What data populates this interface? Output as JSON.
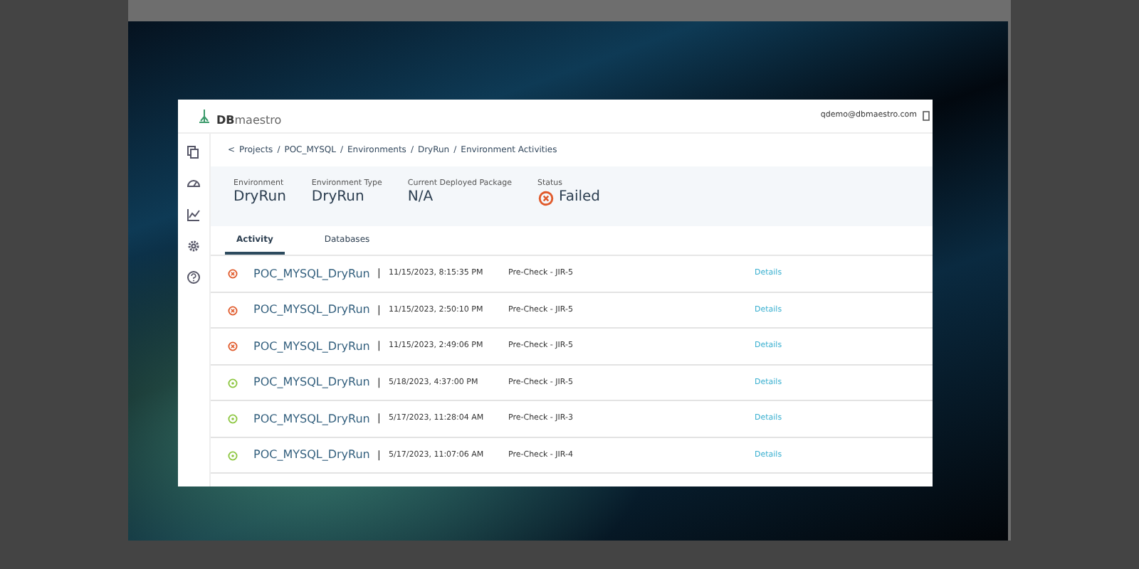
{
  "header": {
    "logo_bold": "DB",
    "logo_rest": "maestro",
    "user_email": "qdemo@dbmaestro.com"
  },
  "breadcrumb": {
    "back": "<",
    "items": [
      {
        "label": "Projects"
      },
      {
        "separator": "/",
        "label": "POC_MYSQL"
      },
      {
        "separator": "/",
        "label": "Environments"
      },
      {
        "separator": "/",
        "label": "DryRun"
      },
      {
        "separator": "/",
        "label": "Environment Activities"
      }
    ]
  },
  "summary": [
    {
      "label": "Environment",
      "value": "DryRun"
    },
    {
      "label": "Environment Type",
      "value": "DryRun"
    },
    {
      "label": "Current Deployed Package",
      "value": "N/A"
    },
    {
      "label": "Status",
      "value": "Failed",
      "kind": "failed"
    }
  ],
  "tabs": [
    {
      "label": "Activity",
      "selected": true
    },
    {
      "label": "Databases",
      "selected": false
    }
  ],
  "activities": [
    {
      "kind": "failed",
      "name": "POC_MYSQL_DryRun",
      "separator": "|",
      "time": "11/15/2023, 8:15:35 PM",
      "action": "Pre-Check - JIR-5",
      "link": "Details"
    },
    {
      "kind": "failed",
      "name": "POC_MYSQL_DryRun",
      "separator": "|",
      "time": "11/15/2023, 2:50:10 PM",
      "action": "Pre-Check - JIR-5",
      "link": "Details"
    },
    {
      "kind": "failed",
      "name": "POC_MYSQL_DryRun",
      "separator": "|",
      "time": "11/15/2023, 2:49:06 PM",
      "action": "Pre-Check - JIR-5",
      "link": "Details"
    },
    {
      "kind": "success",
      "name": "POC_MYSQL_DryRun",
      "separator": "|",
      "time": "5/18/2023, 4:37:00 PM",
      "action": "Pre-Check - JIR-5",
      "link": "Details"
    },
    {
      "kind": "success",
      "name": "POC_MYSQL_DryRun",
      "separator": "|",
      "time": "5/17/2023, 11:28:04 AM",
      "action": "Pre-Check - JIR-3",
      "link": "Details"
    },
    {
      "kind": "success",
      "name": "POC_MYSQL_DryRun",
      "separator": "|",
      "time": "5/17/2023, 11:07:06 AM",
      "action": "Pre-Check - JIR-4",
      "link": "Details"
    }
  ]
}
